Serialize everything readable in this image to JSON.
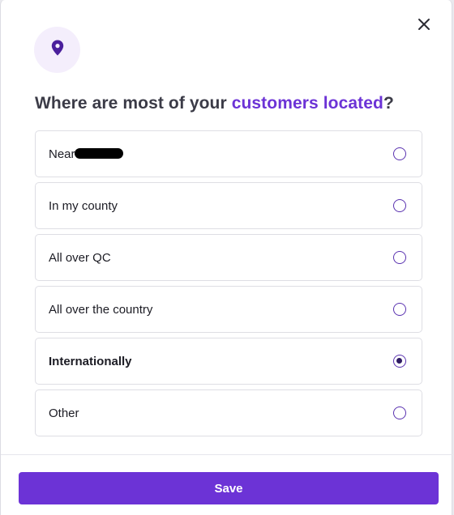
{
  "modal": {
    "title_prefix": "Where are most of your ",
    "title_accent": "customers located",
    "title_suffix": "?",
    "header_icon": "location-pin-icon",
    "close_icon": "close-icon"
  },
  "options": [
    {
      "label": "Near",
      "redacted": true,
      "selected": false
    },
    {
      "label": "In my county",
      "selected": false
    },
    {
      "label": "All over QC",
      "selected": false
    },
    {
      "label": "All over the country",
      "selected": false
    },
    {
      "label": "Internationally",
      "selected": true
    },
    {
      "label": "Other",
      "selected": false
    }
  ],
  "footer": {
    "save_label": "Save"
  },
  "colors": {
    "accent": "#6c33d6",
    "icon_badge_bg": "#f4eefc",
    "radio_border": "#5a32b0",
    "radio_dot": "#2e1a63",
    "title_text": "#3b3b47"
  }
}
